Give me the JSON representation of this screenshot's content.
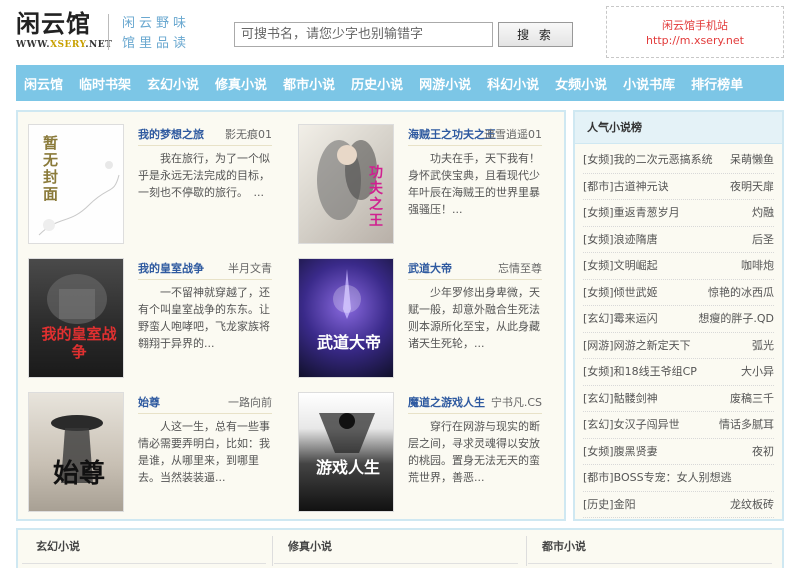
{
  "site": {
    "logo_text": "闲云馆",
    "logo_url_a": "WWW.",
    "logo_url_b": "XSERY",
    "logo_url_c": ".NET",
    "slogan": "闲云野味 馆里品读",
    "mobile_title": "闲云馆手机站",
    "mobile_url": "http://m.xsery.net"
  },
  "search": {
    "placeholder": "可搜书名，请您少字也别输错字",
    "button": "搜 索"
  },
  "nav": [
    "闲云馆",
    "临时书架",
    "玄幻小说",
    "修真小说",
    "都市小说",
    "历史小说",
    "网游小说",
    "科幻小说",
    "女频小说",
    "小说书库",
    "排行榜单"
  ],
  "books": [
    {
      "title": "我的梦想之旅",
      "author": "影无痕01",
      "desc": "我在旅行，为了一个似乎是永远无法完成的目标，一刻也不停歇的旅行。　...",
      "cover_text": "暂无封面"
    },
    {
      "title": "海贼王之功夫之王",
      "author": "追雪逍遥01",
      "desc": "功夫在手，天下我有！身怀武侠宝典，且看现代少年叶辰在海贼王的世界里暴强骚压！...",
      "cover_text": "功夫之王"
    },
    {
      "title": "我的皇室战争",
      "author": "半月文青",
      "desc": "一不留神就穿越了，还有个叫皇室战争的东东。让野蛮人咆哮吧，飞龙家族将翱翔于异界的...",
      "cover_text": "我的皇室战争"
    },
    {
      "title": "武道大帝",
      "author": "忘情至尊",
      "desc": "少年罗修出身卑微，天赋一般，却意外融合生死法则本源所化至宝，从此身藏诸天生死轮，...",
      "cover_text": "武道大帝"
    },
    {
      "title": "始尊",
      "author": "一路向前",
      "desc": "人这一生，总有一些事情必需要弄明白，比如：我是谁，从哪里来，到哪里去。当然装装逼...",
      "cover_text": "始尊"
    },
    {
      "title": "魔道之游戏人生",
      "author": "宁书凡.CS",
      "desc": "穿行在网游与现实的断层之间，寻求灵魂得以安放的桃园。置身无法无天的蛮荒世界，善恶...",
      "cover_text": "游戏人生"
    }
  ],
  "sidebar": {
    "title": "人气小说榜",
    "items": [
      {
        "cat": "[女频]",
        "name": "我的二次元恶搞系统",
        "author": "呆萌懒鱼"
      },
      {
        "cat": "[都市]",
        "name": "古道神元诀",
        "author": "夜明天扉"
      },
      {
        "cat": "[女频]",
        "name": "重返青葱岁月",
        "author": "灼融"
      },
      {
        "cat": "[女频]",
        "name": "浪迹隋唐",
        "author": "后圣"
      },
      {
        "cat": "[女频]",
        "name": "文明崛起",
        "author": "咖啡炮"
      },
      {
        "cat": "[女频]",
        "name": "倾世武姬",
        "author": "惊艳的冰西瓜"
      },
      {
        "cat": "[玄幻]",
        "name": "霉来运闪",
        "author": "想瘦的胖子.QD"
      },
      {
        "cat": "[网游]",
        "name": "网游之新定天下",
        "author": "弧光"
      },
      {
        "cat": "[女频]",
        "name": "和18线王爷组CP",
        "author": "大小异"
      },
      {
        "cat": "[玄幻]",
        "name": "骷髅剑神",
        "author": "废稿三千"
      },
      {
        "cat": "[玄幻]",
        "name": "女汉子闯异世",
        "author": "情话多腻耳"
      },
      {
        "cat": "[女频]",
        "name": "腹黑贤妻",
        "author": "夜初"
      },
      {
        "cat": "[都市]",
        "name": "BOSS专宠：女人别想逃",
        "author": ""
      },
      {
        "cat": "[历史]",
        "name": "金阳",
        "author": "龙纹板砖"
      }
    ]
  },
  "bottom": [
    "玄幻小说",
    "修真小说",
    "都市小说"
  ],
  "colors": {
    "nav_bg": "#7cc6e6",
    "title_blue": "#2f5aa0",
    "mobile_red": "#e23a3a",
    "panel_bg": "#fbfaf2"
  }
}
